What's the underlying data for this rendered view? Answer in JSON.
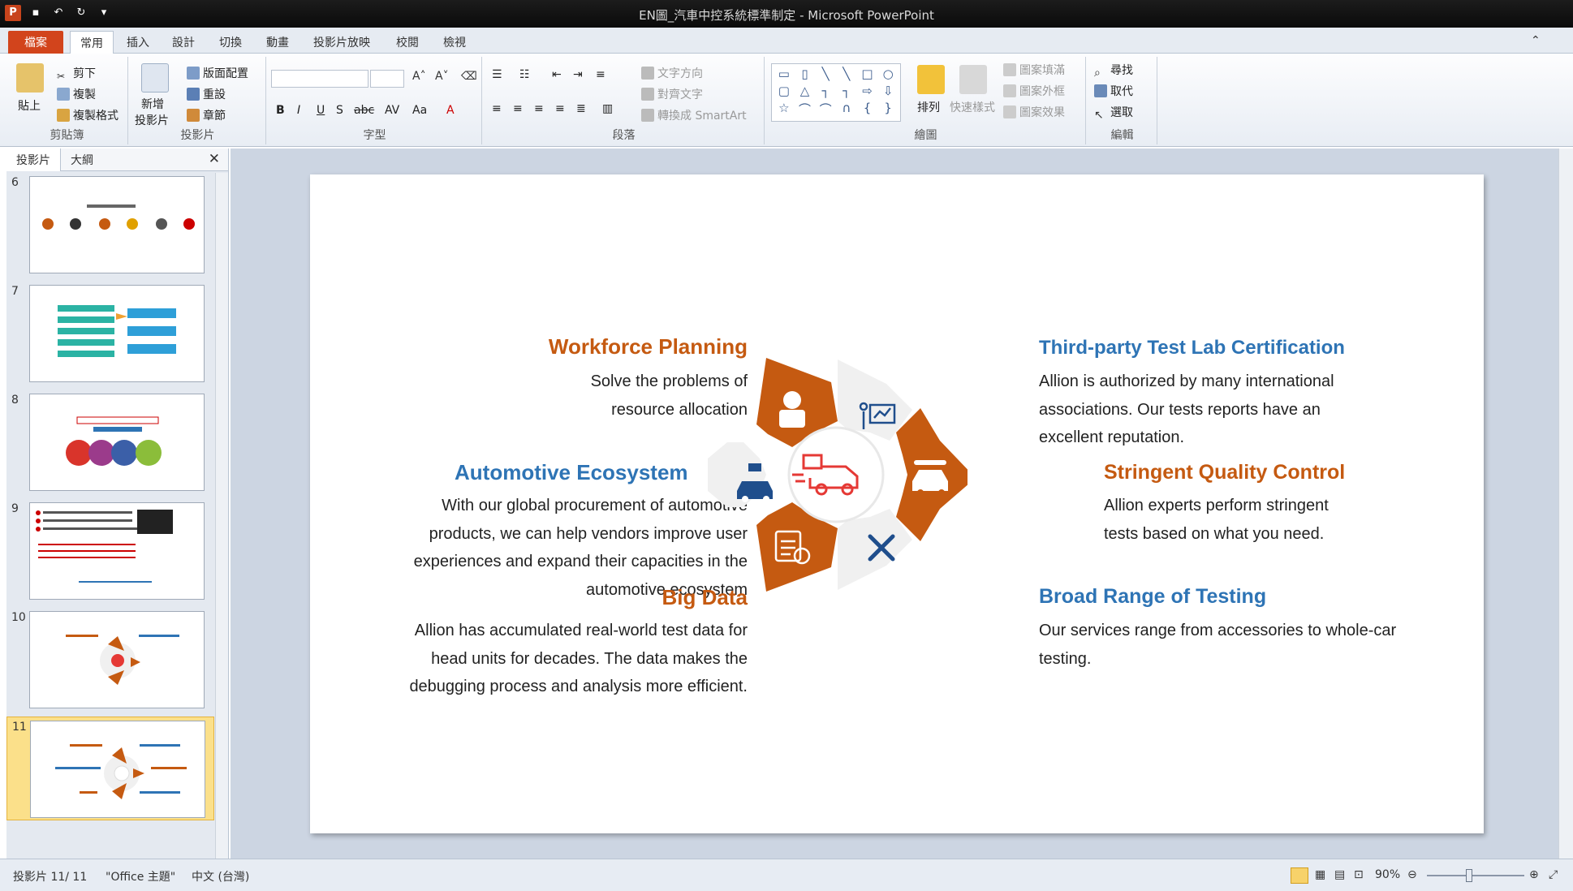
{
  "window": {
    "title": "EN圖_汽車中控系統標準制定 - Microsoft PowerPoint"
  },
  "ribbon_tabs": [
    "檔案",
    "常用",
    "插入",
    "設計",
    "切換",
    "動畫",
    "投影片放映",
    "校閱",
    "檢視"
  ],
  "ribbon": {
    "clipboard": {
      "paste": "貼上",
      "cut": "剪下",
      "copy": "複製",
      "format_painter": "複製格式",
      "label": "剪貼簿"
    },
    "slides": {
      "new_slide": "新增",
      "new_slide2": "投影片",
      "layout": "版面配置",
      "reset": "重設",
      "section": "章節",
      "label": "投影片"
    },
    "font": {
      "label": "字型"
    },
    "paragraph": {
      "text_direction": "文字方向",
      "align_text": "對齊文字",
      "smartart": "轉換成 SmartArt",
      "label": "段落"
    },
    "drawing": {
      "arrange": "排列",
      "quick_styles": "快速樣式",
      "shape_fill": "圖案填滿",
      "shape_outline": "圖案外框",
      "shape_effects": "圖案效果",
      "label": "繪圖"
    },
    "editing": {
      "find": "尋找",
      "replace": "取代",
      "select": "選取",
      "label": "編輯"
    }
  },
  "panel": {
    "tab_slides": "投影片",
    "tab_outline": "大綱",
    "thumb_numbers": [
      "6",
      "7",
      "8",
      "9",
      "10",
      "11"
    ],
    "selected": "11"
  },
  "slide": {
    "workforce": {
      "title": "Workforce Planning",
      "body": [
        "Solve the problems of",
        "resource allocation"
      ]
    },
    "automotive": {
      "title": "Automotive Ecosystem",
      "body": [
        "With our global procurement of automotive",
        "products, we can help vendors improve user",
        "experiences and expand their capacities in the",
        "automotive ecosystem"
      ]
    },
    "bigdata": {
      "title": "Big Data",
      "body": [
        "Allion has accumulated real-world test data for",
        "head units for  decades. The data makes the",
        "debugging process and analysis more efficient."
      ]
    },
    "thirdparty": {
      "title": "Third-party Test Lab Certification",
      "body": [
        "Allion is authorized by many international",
        "associations. Our tests reports have an",
        "excellent reputation."
      ]
    },
    "stringent": {
      "title": "Stringent Quality Control",
      "body": [
        "Allion experts perform stringent",
        "tests based on what you need."
      ]
    },
    "broad": {
      "title": "Broad Range of Testing",
      "body": [
        "Our services range from accessories to whole-car",
        "testing."
      ]
    }
  },
  "colors": {
    "orange": "#c55a11",
    "blue": "#2e74b5",
    "gray": "#f0f0f0",
    "red": "#e53935",
    "navy": "#1f4e8c"
  },
  "status": {
    "slide_count": "投影片 11/ 11",
    "theme": "\"Office 主題\"",
    "language": "中文 (台灣)",
    "zoom": "90%"
  }
}
